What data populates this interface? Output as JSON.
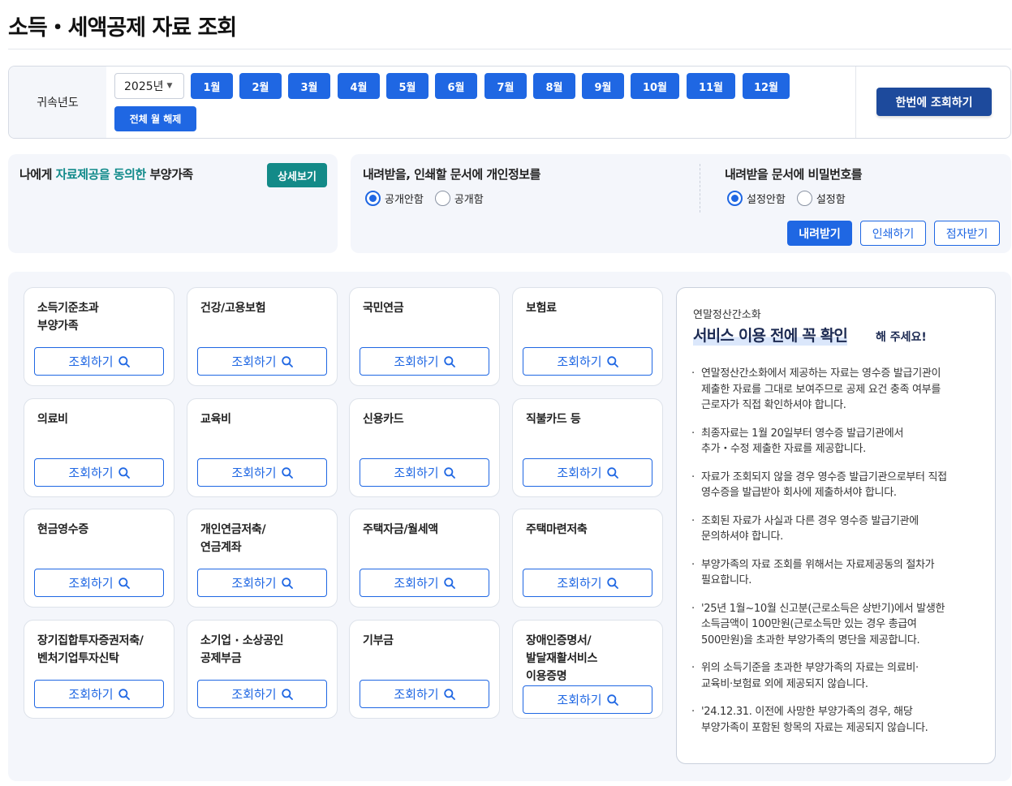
{
  "page": {
    "title": "소득・세액공제 자료 조회"
  },
  "filter": {
    "label": "귀속년도",
    "year": "2025년",
    "months": [
      "1월",
      "2월",
      "3월",
      "4월",
      "5월",
      "6월",
      "7월",
      "8월",
      "9월",
      "10월",
      "11월",
      "12월"
    ],
    "clear_months_label": "전체 월 해제",
    "query_all_label": "한번에 조회하기"
  },
  "dependents": {
    "title_prefix": "나에게 ",
    "title_accent": "자료제공을 동의한",
    "title_suffix": " 부양가족",
    "detail_label": "상세보기"
  },
  "download_options": {
    "privacy": {
      "title": "내려받을, 인쇄할 문서에 개인정보를",
      "options": [
        "공개안함",
        "공개함"
      ],
      "selected": "공개안함"
    },
    "password": {
      "title": "내려받을 문서에 비밀번호를",
      "options": [
        "설정안함",
        "설정함"
      ],
      "selected": "설정안함"
    },
    "actions": {
      "download": "내려받기",
      "print": "인쇄하기",
      "braille": "점자받기"
    }
  },
  "cards": [
    {
      "title": "소득기준초과\n부양가족",
      "button": "조회하기"
    },
    {
      "title": "건강/고용보험",
      "button": "조회하기"
    },
    {
      "title": "국민연금",
      "button": "조회하기"
    },
    {
      "title": "보험료",
      "button": "조회하기"
    },
    {
      "title": "의료비",
      "button": "조회하기"
    },
    {
      "title": "교육비",
      "button": "조회하기"
    },
    {
      "title": "신용카드",
      "button": "조회하기"
    },
    {
      "title": "직불카드 등",
      "button": "조회하기"
    },
    {
      "title": "현금영수증",
      "button": "조회하기"
    },
    {
      "title": "개인연금저축/\n연금계좌",
      "button": "조회하기"
    },
    {
      "title": "주택자금/월세액",
      "button": "조회하기"
    },
    {
      "title": "주택마련저축",
      "button": "조회하기"
    },
    {
      "title": "장기집합투자증권저축/\n벤처기업투자신탁",
      "button": "조회하기"
    },
    {
      "title": "소기업 · 소상공인\n공제부금",
      "button": "조회하기"
    },
    {
      "title": "기부금",
      "button": "조회하기"
    },
    {
      "title": "장애인증명서/\n발달재활서비스\n이용증명",
      "button": "조회하기"
    }
  ],
  "notice": {
    "kicker": "연말정산간소화",
    "heading": "서비스 이용 전에 꼭 확인",
    "suffix": "해 주세요!",
    "items": [
      "연말정산간소화에서 제공하는 자료는 영수증 발급기관이\n제출한 자료를 그대로 보여주므로 공제 요건 충족 여부를\n근로자가 직접 확인하셔야 합니다.",
      "최종자료는 1월 20일부터 영수증 발급기관에서\n추가・수정 제출한 자료를 제공합니다.",
      "자료가 조회되지 않을 경우 영수증 발급기관으로부터 직접\n영수증을 발급받아 회사에 제출하셔야 합니다.",
      "조회된 자료가 사실과 다른 경우 영수증 발급기관에\n문의하셔야 합니다.",
      "부양가족의 자료 조회를 위해서는 자료제공동의 절차가\n필요합니다.",
      "'25년 1월~10월 신고분(근로소득은 상반기)에서 발생한\n소득금액이 100만원(근로소득만 있는 경우 총급여\n500만원)을 초과한 부양가족의 명단을 제공합니다.",
      "위의 소득기준을 초과한 부양가족의 자료는 의료비·\n교육비·보험료 외에 제공되지 않습니다.",
      "'24.12.31. 이전에 사망한 부양가족의 경우, 해당\n부양가족이 포함된 항목의 자료는 제공되지 않습니다."
    ]
  }
}
